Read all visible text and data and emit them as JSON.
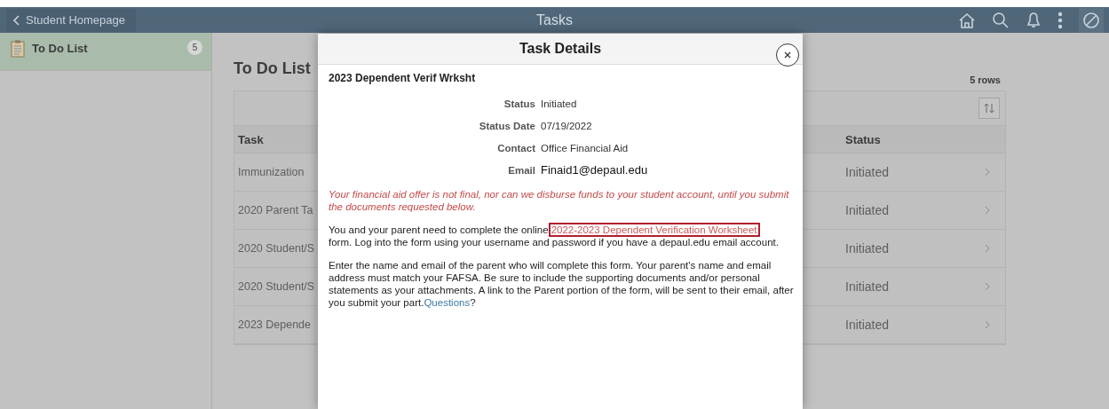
{
  "header": {
    "back_label": "Student Homepage",
    "title": "Tasks"
  },
  "sidebar": {
    "items": [
      {
        "label": "To Do List",
        "count": "5",
        "selected": true
      }
    ]
  },
  "page_title": "To Do List",
  "table": {
    "row_count": "5 rows",
    "columns": [
      "Task",
      "Status"
    ],
    "rows": [
      {
        "task": "Immunization",
        "status": "Initiated"
      },
      {
        "task": "2020 Parent Ta",
        "status": "Initiated"
      },
      {
        "task": "2020 Student/S",
        "status": "Initiated"
      },
      {
        "task": "2020 Student/S",
        "status": "Initiated"
      },
      {
        "task": "2023 Depende",
        "status": "Initiated"
      }
    ]
  },
  "dialog": {
    "title": "Task Details",
    "task_name": "2023 Dependent Verif Wrksht",
    "fields": [
      {
        "label": "Status",
        "value": "Initiated"
      },
      {
        "label": "Status Date",
        "value": "07/19/2022"
      },
      {
        "label": "Contact",
        "value": "Office Financial Aid"
      },
      {
        "label": "Email",
        "value": "Finaid1@depaul.edu"
      }
    ],
    "warning": "Your financial aid offer is not final, nor can we disburse funds to your student account, until you submit the documents requested below.",
    "paragraph_1": {
      "before": "You and your parent need to complete the online",
      "link": "2022-2023 Dependent Verification Worksheet",
      "after": "form.  Log into the form using your username and password if you have a depaul.edu email account."
    },
    "paragraph_2": {
      "before": "Enter the name and email of the parent who will complete this form. Your parent's name and email address must match your FAFSA. Be sure to include the supporting documents and/or personal statements as your attachments.  A link to the Parent portion of the form, will be sent to their email, after you submit your part.",
      "link": "Questions",
      "after": "?"
    }
  }
}
